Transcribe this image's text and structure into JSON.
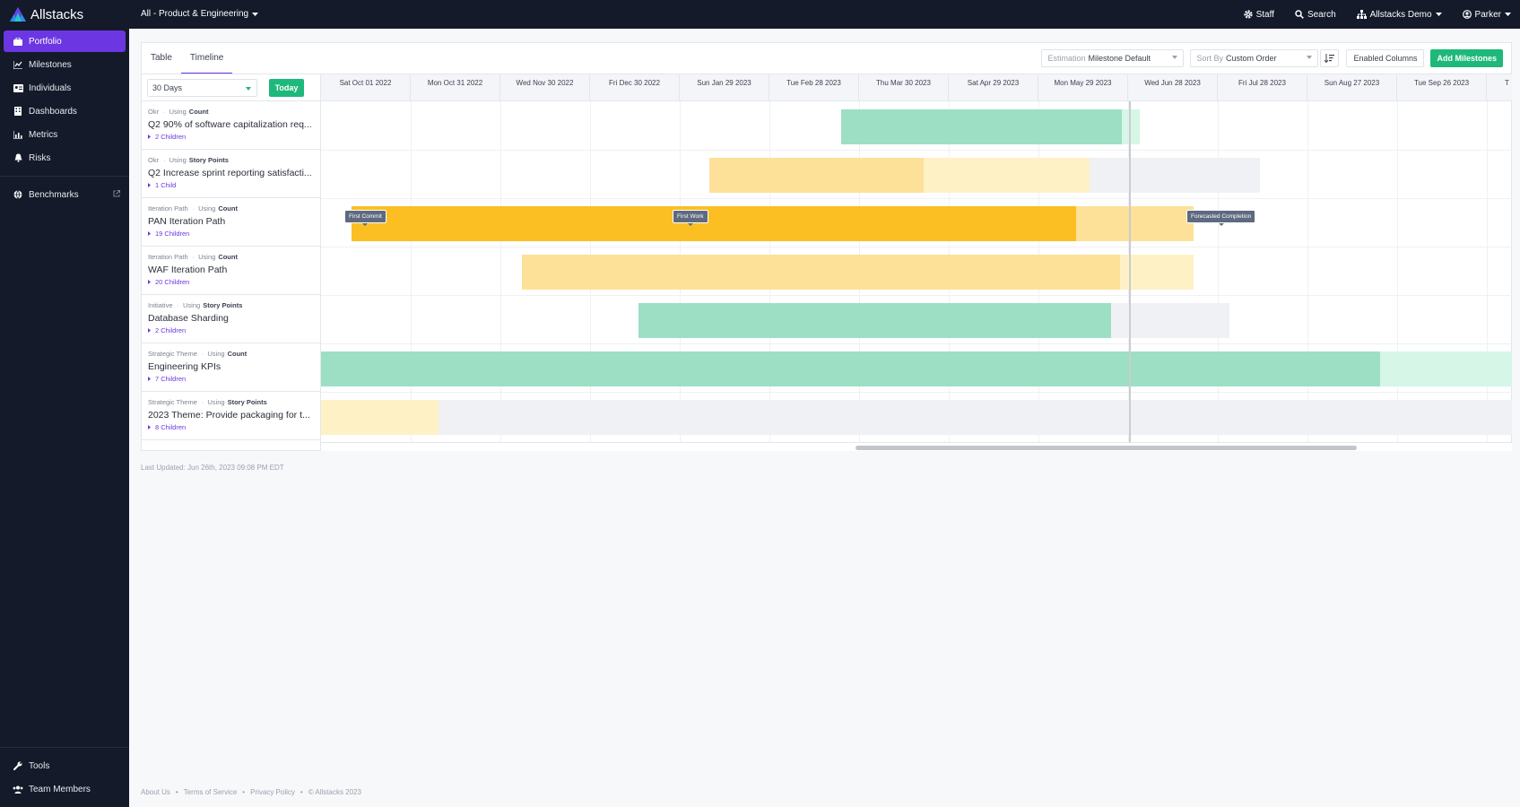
{
  "app": {
    "brand": "Allstacks"
  },
  "sidebar": {
    "items": [
      {
        "label": "Portfolio",
        "icon": "briefcase-icon",
        "active": true
      },
      {
        "label": "Milestones",
        "icon": "chart-icon"
      },
      {
        "label": "Individuals",
        "icon": "id-card-icon"
      },
      {
        "label": "Dashboards",
        "icon": "building-icon"
      },
      {
        "label": "Metrics",
        "icon": "bar-chart-icon"
      },
      {
        "label": "Risks",
        "icon": "bell-icon"
      }
    ],
    "secondary": {
      "label": "Benchmarks",
      "icon": "globe-icon"
    },
    "bottom": [
      {
        "label": "Tools",
        "icon": "wrench-icon"
      },
      {
        "label": "Team Members",
        "icon": "users-icon"
      }
    ]
  },
  "topbar": {
    "scope": "All - Product & Engineering",
    "staff": "Staff",
    "search": "Search",
    "org": "Allstacks Demo",
    "user": "Parker"
  },
  "tabs": [
    "Table",
    "Timeline"
  ],
  "toolbar": {
    "estimation_label": "Estimation",
    "estimation_value": "Milestone Default",
    "sort_label": "Sort By",
    "sort_value": "Custom Order",
    "enabled_columns": "Enabled Columns",
    "add_milestones": "Add Milestones"
  },
  "timeline": {
    "range": "30 Days",
    "today_button": "Today",
    "months": [
      "Sat Oct 01 2022",
      "Mon Oct 31 2022",
      "Wed Nov 30 2022",
      "Fri Dec 30 2022",
      "Sun Jan 29 2023",
      "Tue Feb 28 2023",
      "Thu Mar 30 2023",
      "Sat Apr 29 2023",
      "Mon May 29 2023",
      "Wed Jun 28 2023",
      "Fri Jul 28 2023",
      "Sun Aug 27 2023",
      "Tue Sep 26 2023",
      "T"
    ],
    "markers": {
      "first_commit": "First Commit",
      "first_work": "First Work",
      "forecasted_completion": "Forecasted Completion"
    }
  },
  "milestones": [
    {
      "type": "Okr",
      "using": "Using",
      "unit": "Count",
      "name": "Q2 90% of software capitalization req...",
      "children": "2 Children"
    },
    {
      "type": "Okr",
      "using": "Using",
      "unit": "Story Points",
      "name": "Q2 Increase sprint reporting satisfacti...",
      "children": "1 Child"
    },
    {
      "type": "Iteration Path",
      "using": "Using",
      "unit": "Count",
      "name": "PAN Iteration Path",
      "children": "19 Children"
    },
    {
      "type": "Iteration Path",
      "using": "Using",
      "unit": "Count",
      "name": "WAF Iteration Path",
      "children": "20 Children"
    },
    {
      "type": "Initiative",
      "using": "Using",
      "unit": "Story Points",
      "name": "Database Sharding",
      "children": "2 Children"
    },
    {
      "type": "Strategic Theme",
      "using": "Using",
      "unit": "Count",
      "name": "Engineering KPIs",
      "children": "7 Children"
    },
    {
      "type": "Strategic Theme",
      "using": "Using",
      "unit": "Story Points",
      "name": "2023 Theme: Provide packaging for t...",
      "children": "8 Children"
    }
  ],
  "colors": {
    "accent": "#6c36e2",
    "success": "#1fb87b",
    "green_done": "#9ddfc4",
    "green_remaining": "#d6f6e8",
    "yellow_done": "#fbbf24",
    "yellow_light": "#fde199",
    "yellow_pale": "#fef1c6",
    "grey_forecast": "#eff1f4"
  },
  "last_updated": "Last Updated: Jun 26th, 2023 09:08 PM EDT",
  "footer": {
    "about": "About Us",
    "terms": "Terms of Service",
    "privacy": "Privacy Policy",
    "copyright": "© Allstacks 2023"
  }
}
